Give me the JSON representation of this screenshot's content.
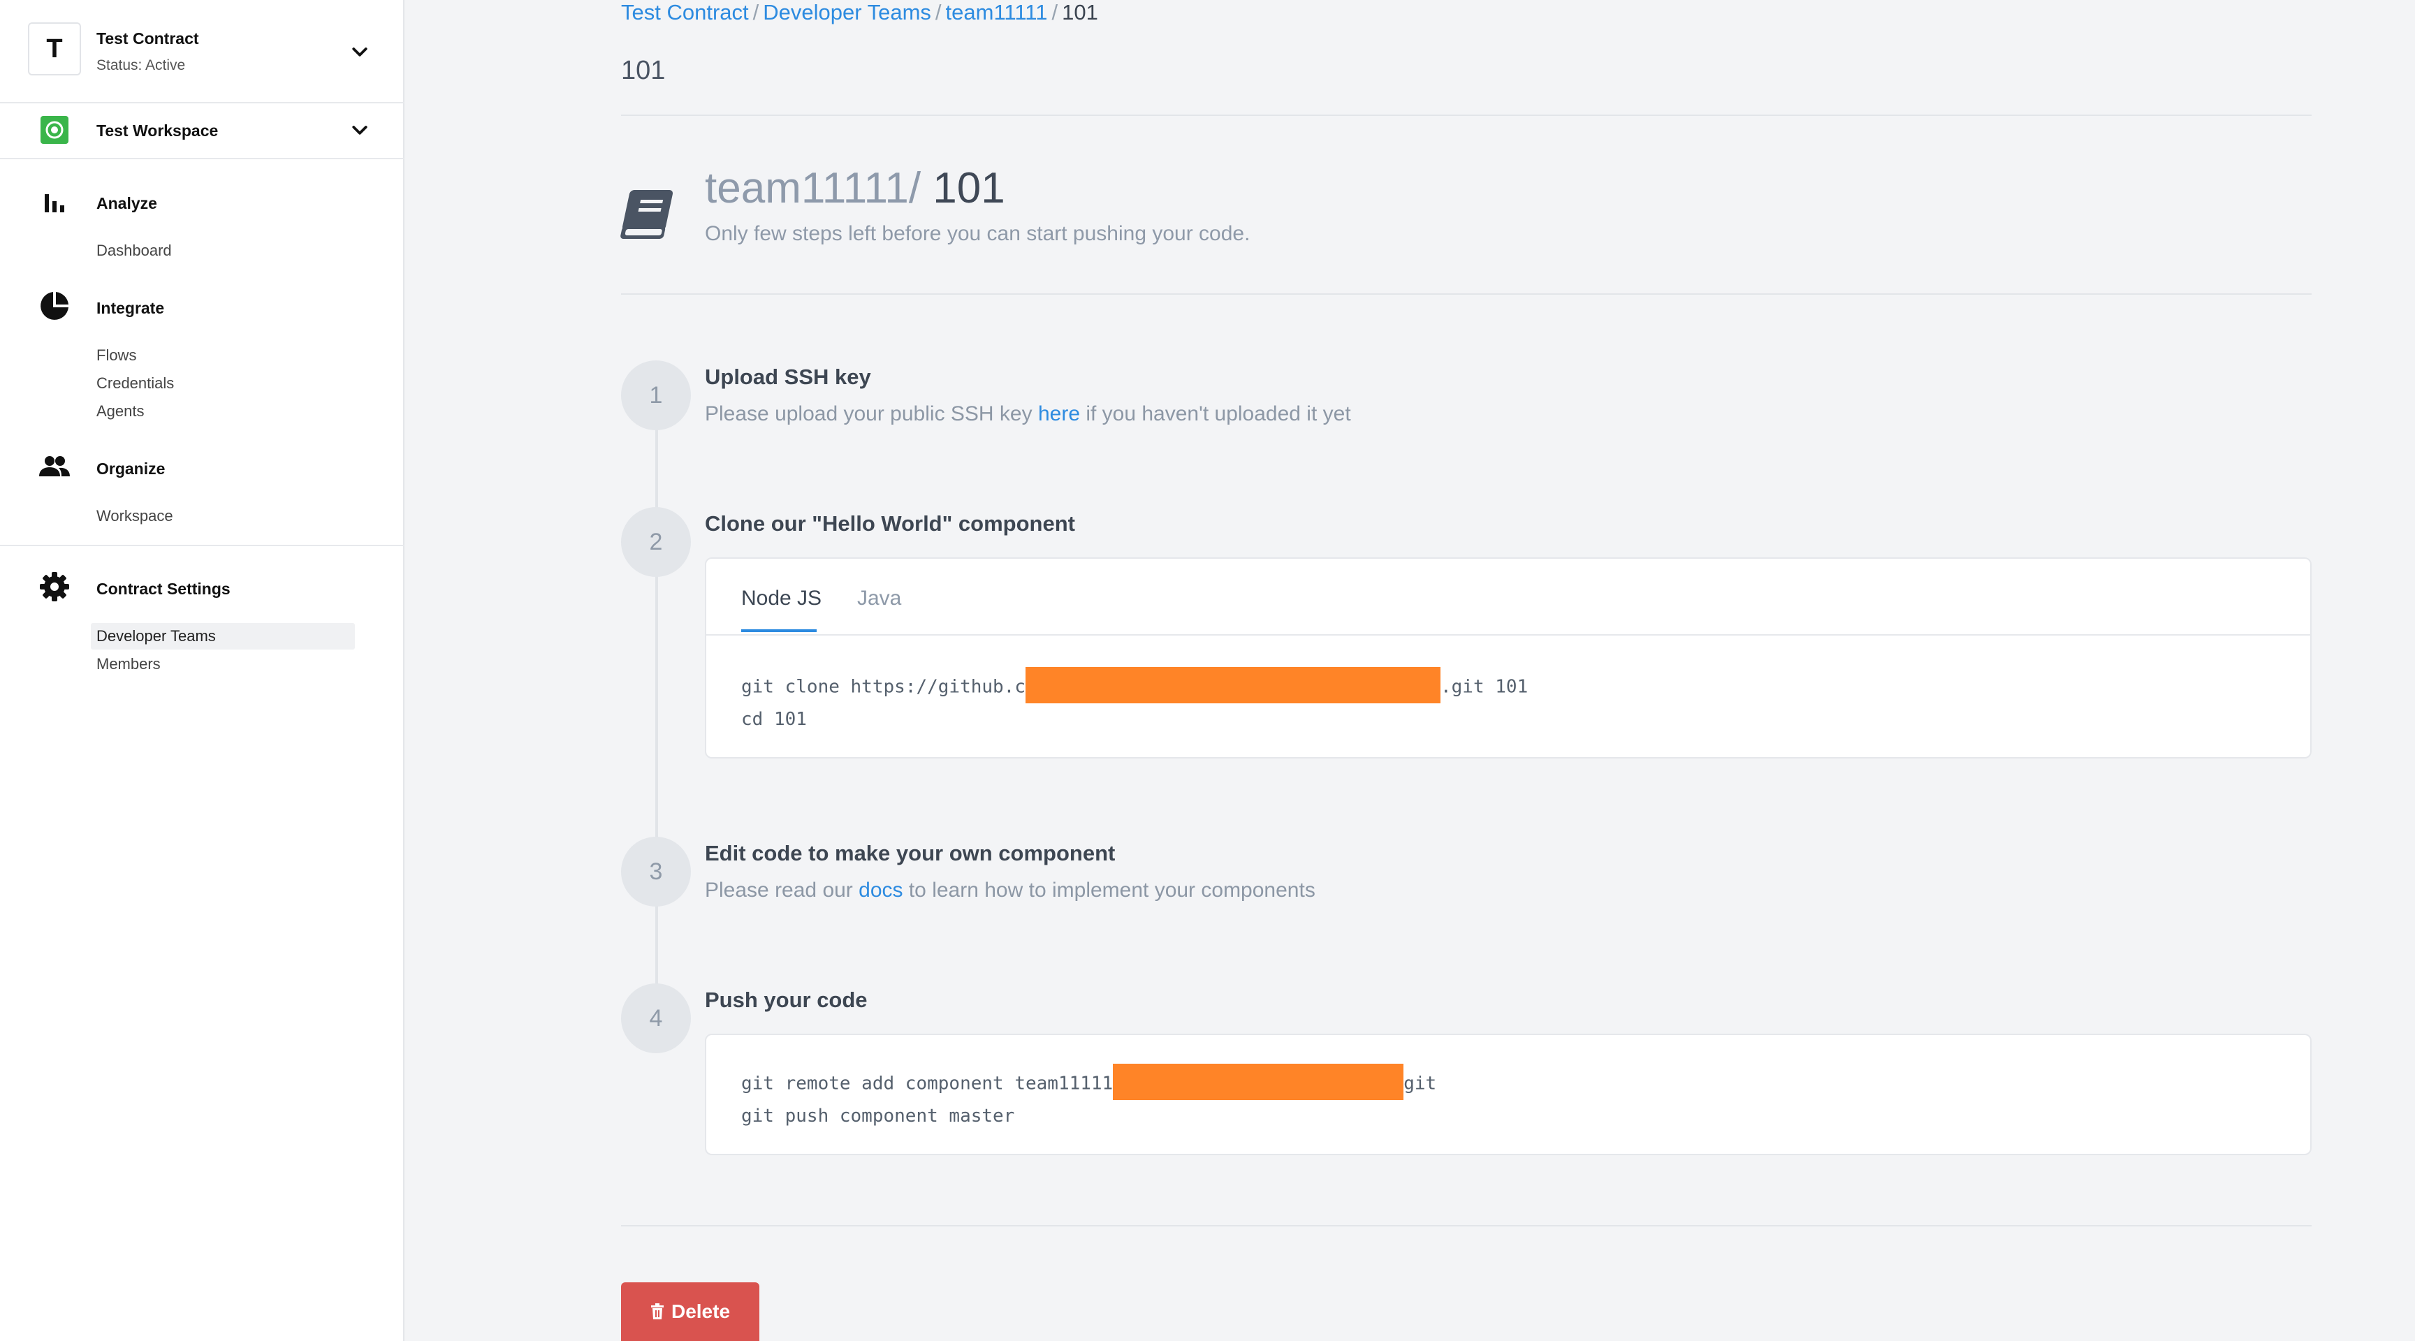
{
  "sidebar": {
    "contract": {
      "avatar_letter": "T",
      "name": "Test Contract",
      "status": "Status: Active"
    },
    "workspace": {
      "name": "Test Workspace"
    },
    "sections": {
      "analyze": {
        "title": "Analyze",
        "links": [
          "Dashboard"
        ]
      },
      "integrate": {
        "title": "Integrate",
        "links": [
          "Flows",
          "Credentials",
          "Agents"
        ]
      },
      "organize": {
        "title": "Organize",
        "links": [
          "Workspace"
        ]
      },
      "contract_settings": {
        "title": "Contract Settings",
        "links": [
          "Developer Teams",
          "Members"
        ],
        "active": "Developer Teams"
      }
    }
  },
  "breadcrumb": {
    "items": [
      "Test Contract",
      "Developer Teams",
      "team11111"
    ],
    "separator": "/",
    "current": "101"
  },
  "page_title": "101",
  "repo": {
    "owner": "team11111/",
    "name": "101",
    "subtitle": "Only few steps left before you can start pushing your code."
  },
  "steps": {
    "s1": {
      "number": "1",
      "title": "Upload SSH key",
      "desc_before": "Please upload your public SSH key ",
      "link": "here",
      "desc_after": " if you haven't uploaded it yet"
    },
    "s2": {
      "number": "2",
      "title": "Clone our \"Hello World\" component",
      "tabs": [
        "Node JS",
        "Java"
      ],
      "active_tab": "Node JS",
      "code_line1_before": "git clone https://github.c",
      "code_line1_after": ".git 101",
      "code_line2": "cd 101"
    },
    "s3": {
      "number": "3",
      "title": "Edit code to make your own component",
      "desc_before": "Please read our ",
      "link": "docs",
      "desc_after": " to learn how to implement your components"
    },
    "s4": {
      "number": "4",
      "title": "Push your code",
      "code_line1_before": "git remote add component team11111",
      "code_line1_after": "git",
      "code_line2": "git push component master"
    }
  },
  "delete_label": "Delete",
  "colors": {
    "accent": "#2d8be0",
    "danger": "#d9534f",
    "redaction": "#ff8427",
    "workspace_icon": "#3ab54a"
  }
}
